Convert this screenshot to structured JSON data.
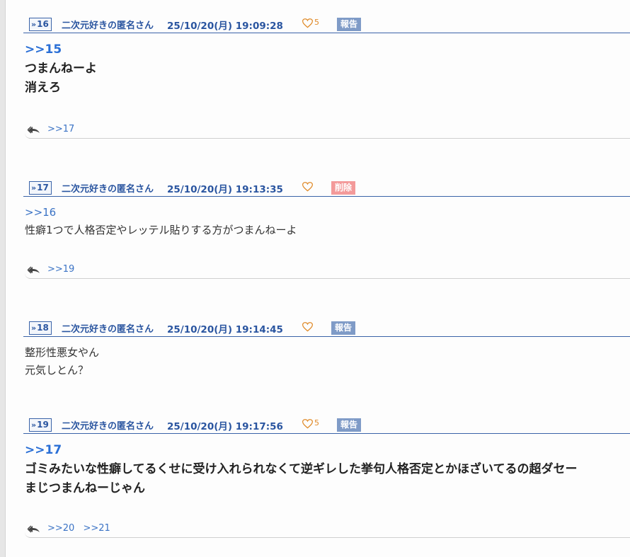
{
  "posts": [
    {
      "number": "16",
      "name": "二次元好きの匿名さん",
      "datetime": "25/10/20(月) 19:09:28",
      "likes": "5",
      "badge": "報告",
      "lines": [
        ">>15",
        "つまんねーよ",
        "消えろ"
      ],
      "replies": [
        ">>17"
      ]
    },
    {
      "number": "17",
      "name": "二次元好きの匿名さん",
      "datetime": "25/10/20(月) 19:13:35",
      "likes": "",
      "badge": "削除",
      "lines": [
        ">>16",
        "性癖1つで人格否定やレッテル貼りする方がつまんねーよ"
      ],
      "replies": [
        ">>19"
      ]
    },
    {
      "number": "18",
      "name": "二次元好きの匿名さん",
      "datetime": "25/10/20(月) 19:14:45",
      "likes": "",
      "badge": "報告",
      "lines": [
        "整形性悪女やん",
        "元気しとん？"
      ],
      "replies": []
    },
    {
      "number": "19",
      "name": "二次元好きの匿名さん",
      "datetime": "25/10/20(月) 19:17:56",
      "likes": "5",
      "badge": "報告",
      "lines": [
        ">>17",
        "ゴミみたいな性癖してるくせに受け入れられなくて逆ギレした挙句人格否定とかほざいてるの超ダセー",
        "まじつまんねーじゃん"
      ],
      "replies": [
        ">>20",
        ">>21"
      ]
    }
  ],
  "colors": {
    "header_text": "#2a55a0",
    "heart": "#e08b2a",
    "report_badge": "#7f9bc7",
    "delete_badge": "#f39a9a",
    "anchor": "#2a6fd6"
  }
}
